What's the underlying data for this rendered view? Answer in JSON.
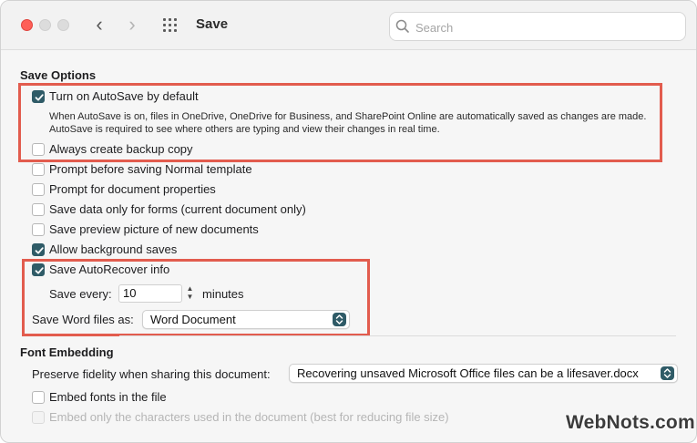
{
  "window": {
    "title": "Save",
    "search_placeholder": "Search"
  },
  "save_options": {
    "title": "Save Options",
    "autosave_label": "Turn on AutoSave by default",
    "autosave_checked": true,
    "autosave_description": "When AutoSave is on, files in OneDrive, OneDrive for Business, and SharePoint Online are automatically saved as changes are made. AutoSave is required to see where others are typing and view their changes in real time.",
    "backup_label": "Always create backup copy",
    "prompt_normal_label": "Prompt before saving Normal template",
    "prompt_props_label": "Prompt for document properties",
    "forms_only_label": "Save data only for forms (current document only)",
    "preview_label": "Save preview picture of new documents",
    "background_label": "Allow background saves",
    "background_checked": true,
    "autorecover_label": "Save AutoRecover info",
    "autorecover_checked": true,
    "save_every_label": "Save every:",
    "save_every_value": "10",
    "minutes_label": "minutes",
    "save_format_label": "Save Word files as:",
    "save_format_value": "Word Document"
  },
  "font_embedding": {
    "title": "Font Embedding",
    "fidelity_label": "Preserve fidelity when sharing this document:",
    "fidelity_document": "Recovering unsaved Microsoft Office files can be a lifesaver.docx",
    "embed_label": "Embed fonts in the file",
    "embed_only_label": "Embed only the characters used in the document (best for reducing file size)"
  },
  "watermark": "WebNots.com",
  "colors": {
    "highlight": "#e25c4e",
    "checkbox_accent": "#2f5b67"
  }
}
